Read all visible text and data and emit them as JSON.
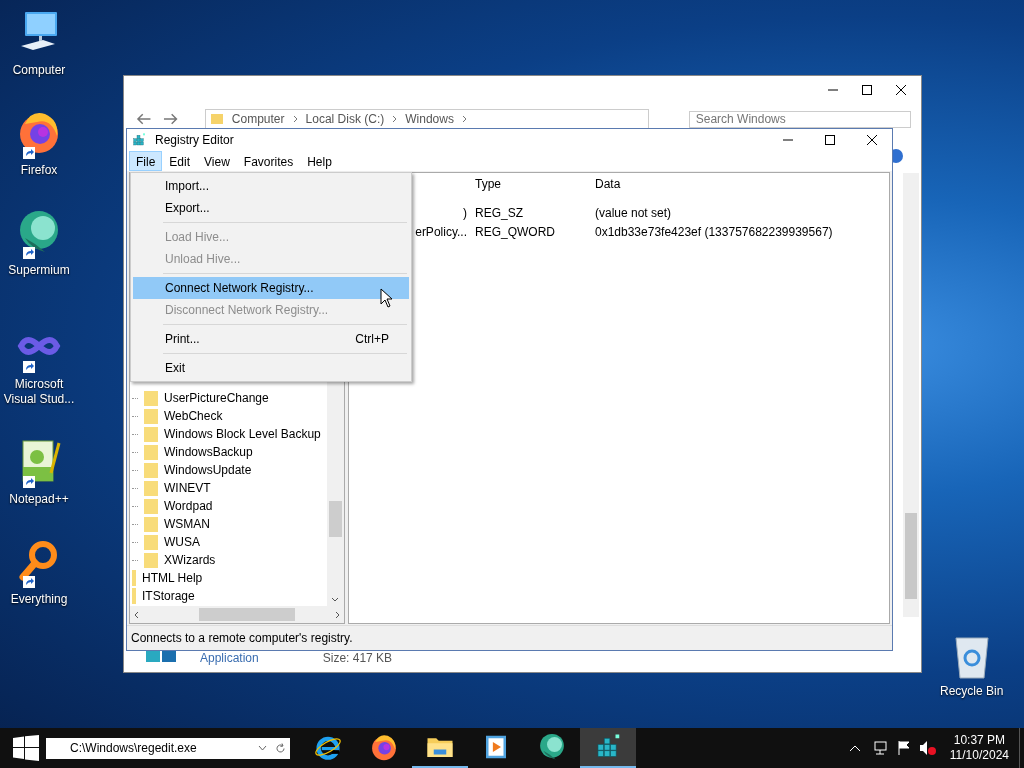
{
  "desktop_icons": [
    {
      "label": "Computer",
      "kind": "computer",
      "shortcut": false
    },
    {
      "label": "Firefox",
      "kind": "firefox",
      "shortcut": true
    },
    {
      "label": "Supermium",
      "kind": "supermium",
      "shortcut": true
    },
    {
      "label": "Microsoft Visual Stud...",
      "kind": "visualstudio",
      "shortcut": true
    },
    {
      "label": "Notepad++",
      "kind": "notepad",
      "shortcut": true
    },
    {
      "label": "Everything",
      "kind": "everything",
      "shortcut": true
    }
  ],
  "recycle_bin": {
    "label": "Recycle Bin"
  },
  "explorer": {
    "breadcrumb": [
      "Computer",
      "Local Disk (C:)",
      "Windows"
    ],
    "search": {
      "placeholder": "Search Windows"
    },
    "details": [
      "Application",
      "Size: 417 KB"
    ]
  },
  "regedit": {
    "title": "Registry Editor",
    "menu_bar": [
      {
        "label": "File",
        "selected": true
      },
      {
        "label": "Edit",
        "selected": false
      },
      {
        "label": "View",
        "selected": false
      },
      {
        "label": "Favorites",
        "selected": false
      },
      {
        "label": "Help",
        "selected": false
      }
    ],
    "tree": [
      {
        "children": [
          {
            "label": "UserPictureChange"
          },
          {
            "label": "WebCheck"
          },
          {
            "label": "Windows Block Level Backup"
          },
          {
            "label": "WindowsBackup"
          },
          {
            "label": "WindowsUpdate"
          },
          {
            "label": "WINEVT"
          },
          {
            "label": "Wordpad"
          },
          {
            "label": "WSMAN"
          },
          {
            "label": "WUSA"
          },
          {
            "label": "XWizards"
          }
        ]
      },
      {
        "label": "HTML Help"
      },
      {
        "label": "ITStorage"
      }
    ],
    "columns": [
      "Type",
      "Data"
    ],
    "rows": [
      {
        "name": ")",
        "type": "REG_SZ",
        "data": "(value not set)"
      },
      {
        "name": "erPolicy...",
        "type": "REG_QWORD",
        "data": "0x1db33e73fe423ef (133757682239939567)"
      }
    ],
    "status": "Connects to a remote computer's registry."
  },
  "file_menu": [
    {
      "kind": "item",
      "label": "Import...",
      "disabled": false,
      "selected": false
    },
    {
      "kind": "item",
      "label": "Export...",
      "disabled": false,
      "selected": false
    },
    {
      "kind": "separator"
    },
    {
      "kind": "item",
      "label": "Load Hive...",
      "disabled": true,
      "selected": false
    },
    {
      "kind": "item",
      "label": "Unload Hive...",
      "disabled": true,
      "selected": false
    },
    {
      "kind": "separator"
    },
    {
      "kind": "item",
      "label": "Connect Network Registry...",
      "disabled": false,
      "selected": true
    },
    {
      "kind": "item",
      "label": "Disconnect Network Registry...",
      "disabled": true,
      "selected": false
    },
    {
      "kind": "separator"
    },
    {
      "kind": "item",
      "label": "Print...",
      "shortcut": "Ctrl+P",
      "disabled": false,
      "selected": false
    },
    {
      "kind": "separator"
    },
    {
      "kind": "item",
      "label": "Exit",
      "disabled": false,
      "selected": false
    }
  ],
  "taskbar": {
    "address": "C:\\Windows\\regedit.exe",
    "apps": [
      {
        "kind": "ie",
        "running": false,
        "selected": false
      },
      {
        "kind": "firefox",
        "running": false,
        "selected": false
      },
      {
        "kind": "explorer",
        "running": true,
        "selected": false
      },
      {
        "kind": "media",
        "running": false,
        "selected": false
      },
      {
        "kind": "supermium",
        "running": false,
        "selected": false
      },
      {
        "kind": "regedit",
        "running": true,
        "selected": true
      }
    ],
    "time": "10:37 PM",
    "date": "11/10/2024"
  }
}
